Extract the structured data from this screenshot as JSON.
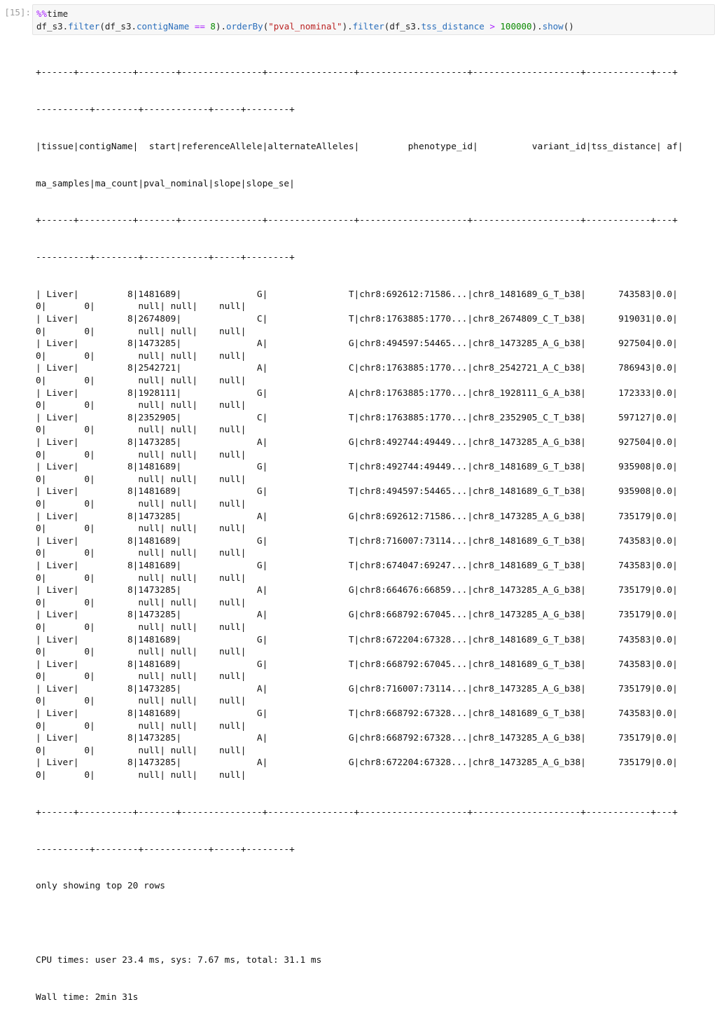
{
  "cell": {
    "prompt": "[15]:",
    "magic_prefix": "%%",
    "magic_name": "time",
    "code": {
      "obj1": "df_s3",
      "dot1": ".",
      "m_filter": "filter",
      "p_open1": "(",
      "obj2": "df_s3",
      "dot2": ".",
      "attr_contig": "contigName",
      "op_eq": " == ",
      "num_8": "8",
      "p_close1": ")",
      "dot3": ".",
      "m_orderby": "orderBy",
      "p_open2": "(",
      "str_pval": "\"pval_nominal\"",
      "p_close2": ")",
      "dot4": ".",
      "m_filter2": "filter",
      "p_open3": "(",
      "obj3": "df_s3",
      "dot5": ".",
      "attr_tss": "tss_distance",
      "op_gt": " > ",
      "num_100000": "100000",
      "p_close3": ")",
      "dot6": ".",
      "m_show": "show",
      "p_call": "()"
    }
  },
  "output": {
    "border_top": "+------+----------+-------+---------------+----------------+--------------------+--------------------+------------+---+",
    "border_cont": "----------+--------+------------+-----+--------+",
    "header_line1": "|tissue|contigName|  start|referenceAllele|alternateAlleles|         phenotype_id|          variant_id|tss_distance| af|",
    "header_line2": "ma_samples|ma_count|pval_nominal|slope|slope_se|",
    "rows": [
      {
        "a": "| Liver|         8|1481689|              G|               T|chr8:692612:71586...|chr8_1481689_G_T_b38|      743583|0.0|",
        "b": "0|       0|        null| null|    null|"
      },
      {
        "a": "| Liver|         8|2674809|              C|               T|chr8:1763885:1770...|chr8_2674809_C_T_b38|      919031|0.0|",
        "b": "0|       0|        null| null|    null|"
      },
      {
        "a": "| Liver|         8|1473285|              A|               G|chr8:494597:54465...|chr8_1473285_A_G_b38|      927504|0.0|",
        "b": "0|       0|        null| null|    null|"
      },
      {
        "a": "| Liver|         8|2542721|              A|               C|chr8:1763885:1770...|chr8_2542721_A_C_b38|      786943|0.0|",
        "b": "0|       0|        null| null|    null|"
      },
      {
        "a": "| Liver|         8|1928111|              G|               A|chr8:1763885:1770...|chr8_1928111_G_A_b38|      172333|0.0|",
        "b": "0|       0|        null| null|    null|"
      },
      {
        "a": "| Liver|         8|2352905|              C|               T|chr8:1763885:1770...|chr8_2352905_C_T_b38|      597127|0.0|",
        "b": "0|       0|        null| null|    null|"
      },
      {
        "a": "| Liver|         8|1473285|              A|               G|chr8:492744:49449...|chr8_1473285_A_G_b38|      927504|0.0|",
        "b": "0|       0|        null| null|    null|"
      },
      {
        "a": "| Liver|         8|1481689|              G|               T|chr8:492744:49449...|chr8_1481689_G_T_b38|      935908|0.0|",
        "b": "0|       0|        null| null|    null|"
      },
      {
        "a": "| Liver|         8|1481689|              G|               T|chr8:494597:54465...|chr8_1481689_G_T_b38|      935908|0.0|",
        "b": "0|       0|        null| null|    null|"
      },
      {
        "a": "| Liver|         8|1473285|              A|               G|chr8:692612:71586...|chr8_1473285_A_G_b38|      735179|0.0|",
        "b": "0|       0|        null| null|    null|"
      },
      {
        "a": "| Liver|         8|1481689|              G|               T|chr8:716007:73114...|chr8_1481689_G_T_b38|      743583|0.0|",
        "b": "0|       0|        null| null|    null|"
      },
      {
        "a": "| Liver|         8|1481689|              G|               T|chr8:674047:69247...|chr8_1481689_G_T_b38|      743583|0.0|",
        "b": "0|       0|        null| null|    null|"
      },
      {
        "a": "| Liver|         8|1473285|              A|               G|chr8:664676:66859...|chr8_1473285_A_G_b38|      735179|0.0|",
        "b": "0|       0|        null| null|    null|"
      },
      {
        "a": "| Liver|         8|1473285|              A|               G|chr8:668792:67045...|chr8_1473285_A_G_b38|      735179|0.0|",
        "b": "0|       0|        null| null|    null|"
      },
      {
        "a": "| Liver|         8|1481689|              G|               T|chr8:672204:67328...|chr8_1481689_G_T_b38|      743583|0.0|",
        "b": "0|       0|        null| null|    null|"
      },
      {
        "a": "| Liver|         8|1481689|              G|               T|chr8:668792:67045...|chr8_1481689_G_T_b38|      743583|0.0|",
        "b": "0|       0|        null| null|    null|"
      },
      {
        "a": "| Liver|         8|1473285|              A|               G|chr8:716007:73114...|chr8_1473285_A_G_b38|      735179|0.0|",
        "b": "0|       0|        null| null|    null|"
      },
      {
        "a": "| Liver|         8|1481689|              G|               T|chr8:668792:67328...|chr8_1481689_G_T_b38|      743583|0.0|",
        "b": "0|       0|        null| null|    null|"
      },
      {
        "a": "| Liver|         8|1473285|              A|               G|chr8:668792:67328...|chr8_1473285_A_G_b38|      735179|0.0|",
        "b": "0|       0|        null| null|    null|"
      },
      {
        "a": "| Liver|         8|1473285|              A|               G|chr8:672204:67328...|chr8_1473285_A_G_b38|      735179|0.0|",
        "b": "0|       0|        null| null|    null|"
      }
    ],
    "footer": "only showing top 20 rows",
    "cpu_times": "CPU times: user 23.4 ms, sys: 7.67 ms, total: 31.1 ms",
    "wall_time": "Wall time: 2min 31s"
  }
}
